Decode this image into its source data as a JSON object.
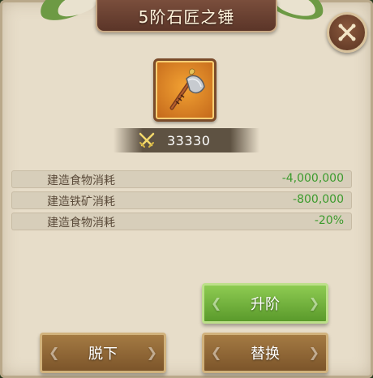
{
  "dialog": {
    "title": "5阶石匠之锤",
    "close_icon": "close-icon"
  },
  "item": {
    "icon": "axe-icon",
    "power_icon": "crossed-swords-icon",
    "power_value": "33330"
  },
  "stats": [
    {
      "label": "建造食物消耗",
      "value": "-4,000,000"
    },
    {
      "label": "建造铁矿消耗",
      "value": "-800,000"
    },
    {
      "label": "建造食物消耗",
      "value": "-20%"
    }
  ],
  "buttons": {
    "upgrade": "升阶",
    "remove": "脱下",
    "replace": "替换"
  },
  "colors": {
    "stat_value": "#3c9b2d",
    "title_plate": "#5b3528",
    "green_button": "#6fb03a",
    "brown_button": "#8e6533"
  }
}
